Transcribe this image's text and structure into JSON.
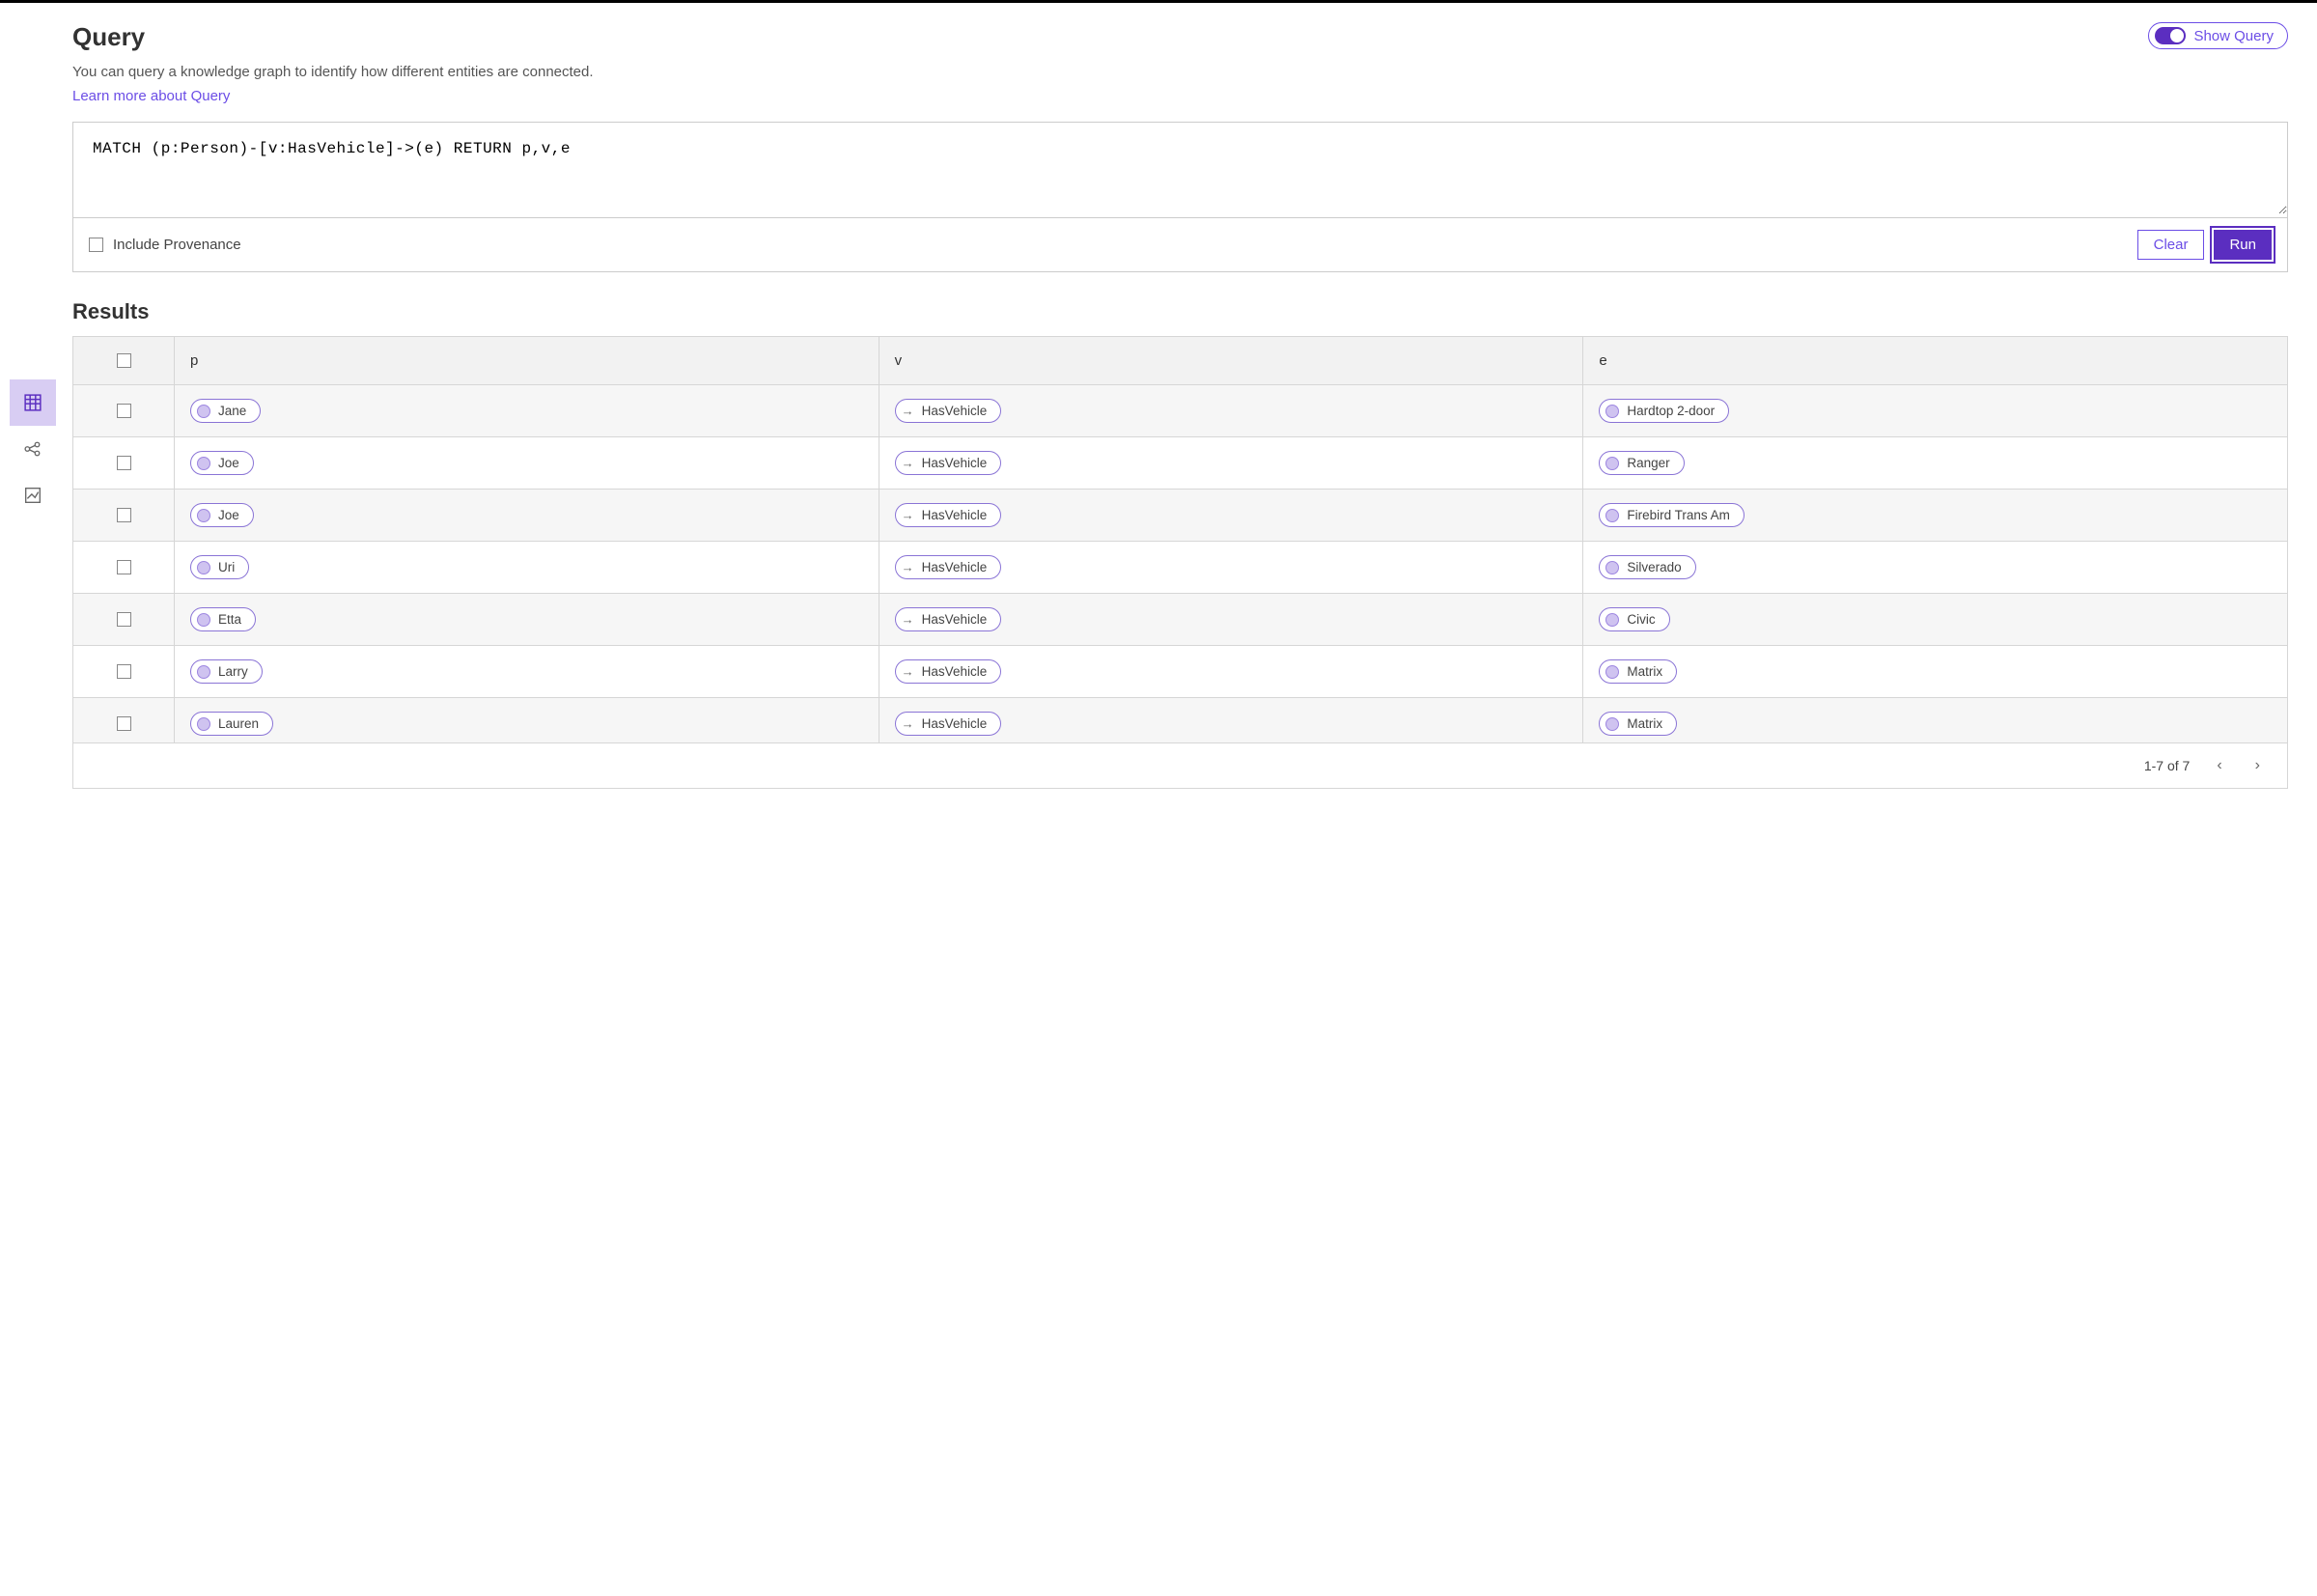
{
  "header": {
    "title": "Query",
    "subtitle": "You can query a knowledge graph to identify how different entities are connected.",
    "learn_link": "Learn more about Query",
    "show_query_label": "Show Query"
  },
  "query": {
    "text": "MATCH (p:Person)-[v:HasVehicle]->(e) RETURN p,v,e",
    "include_provenance_label": "Include Provenance",
    "clear_label": "Clear",
    "run_label": "Run"
  },
  "results": {
    "title": "Results",
    "columns": [
      "p",
      "v",
      "e"
    ],
    "rows": [
      {
        "p": "Jane",
        "v": "HasVehicle",
        "e": "Hardtop 2-door"
      },
      {
        "p": "Joe",
        "v": "HasVehicle",
        "e": "Ranger"
      },
      {
        "p": "Joe",
        "v": "HasVehicle",
        "e": "Firebird Trans Am"
      },
      {
        "p": "Uri",
        "v": "HasVehicle",
        "e": "Silverado"
      },
      {
        "p": "Etta",
        "v": "HasVehicle",
        "e": "Civic"
      },
      {
        "p": "Larry",
        "v": "HasVehicle",
        "e": "Matrix"
      },
      {
        "p": "Lauren",
        "v": "HasVehicle",
        "e": "Matrix"
      }
    ],
    "pager": "1-7 of 7"
  },
  "colors": {
    "accent": "#5b2ec0"
  }
}
